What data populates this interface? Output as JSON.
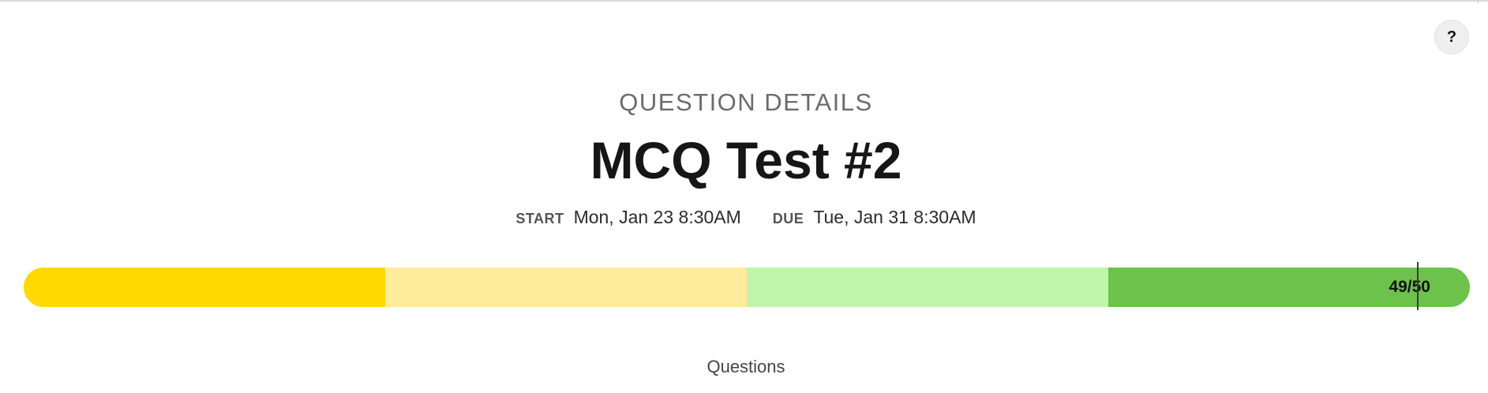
{
  "header": {
    "help_label": "?"
  },
  "details": {
    "section_label": "QUESTION DETAILS",
    "title": "MCQ Test #2",
    "start_label": "START",
    "start_value": "Mon, Jan 23 8:30AM",
    "due_label": "DUE",
    "due_value": "Tue, Jan 31 8:30AM"
  },
  "progress": {
    "score_text": "49/50",
    "score": 49,
    "max": 50,
    "segment_colors": [
      "#ffd900",
      "#ffeb9c",
      "#bff5ab",
      "#6cc24a"
    ]
  },
  "footer": {
    "questions_label": "Questions"
  }
}
